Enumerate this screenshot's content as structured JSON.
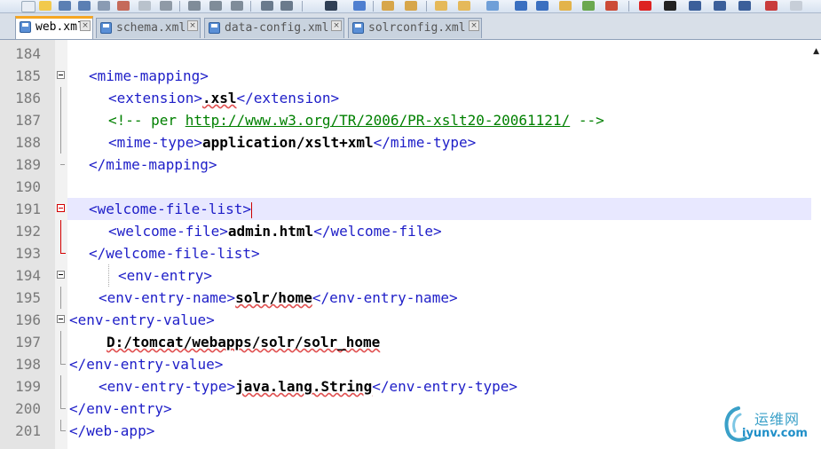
{
  "tabs": [
    {
      "label": "web.xml",
      "active": true
    },
    {
      "label": "schema.xml",
      "active": false
    },
    {
      "label": "data-config.xml",
      "active": false
    },
    {
      "label": "solrconfig.xml",
      "active": false
    }
  ],
  "tab_close_glyph": "×",
  "lines": [
    {
      "num": "184"
    },
    {
      "num": "185",
      "open": "<mime-mapping>"
    },
    {
      "num": "186",
      "open": "<extension>",
      "value": ".xsl",
      "close": "</extension>"
    },
    {
      "num": "187",
      "comment_start": "<!-- per ",
      "link": "http://www.w3.org/TR/2006/PR-xslt20-20061121/",
      "comment_end": " -->"
    },
    {
      "num": "188",
      "open": "<mime-type>",
      "value": "application/xslt+xml",
      "close": "</mime-type>"
    },
    {
      "num": "189",
      "close": "</mime-mapping>"
    },
    {
      "num": "190"
    },
    {
      "num": "191",
      "open": "<welcome-file-list>"
    },
    {
      "num": "192",
      "open": "<welcome-file>",
      "value": "admin.html",
      "close": "</welcome-file>"
    },
    {
      "num": "193",
      "close": "</welcome-file-list>"
    },
    {
      "num": "194",
      "open": "<env-entry>"
    },
    {
      "num": "195",
      "open": "<env-entry-name>",
      "value": "solr/home",
      "close": "</env-entry-name>"
    },
    {
      "num": "196",
      "open": "<env-entry-value>"
    },
    {
      "num": "197",
      "value": "D:/tomcat/webapps/solr/solr_home"
    },
    {
      "num": "198",
      "close": "</env-entry-value>"
    },
    {
      "num": "199",
      "open": "<env-entry-type>",
      "value": "java.lang.String",
      "close": "</env-entry-type>"
    },
    {
      "num": "200",
      "close": "</env-entry>"
    },
    {
      "num": "201",
      "close": "</web-app>"
    }
  ],
  "watermark": {
    "cn": "运维网",
    "en": "iyunv.com"
  },
  "colors": {
    "tag": "#1e1ec8",
    "comment": "#008000",
    "fold_active": "#d40000",
    "current_line": "#e8e8ff"
  }
}
